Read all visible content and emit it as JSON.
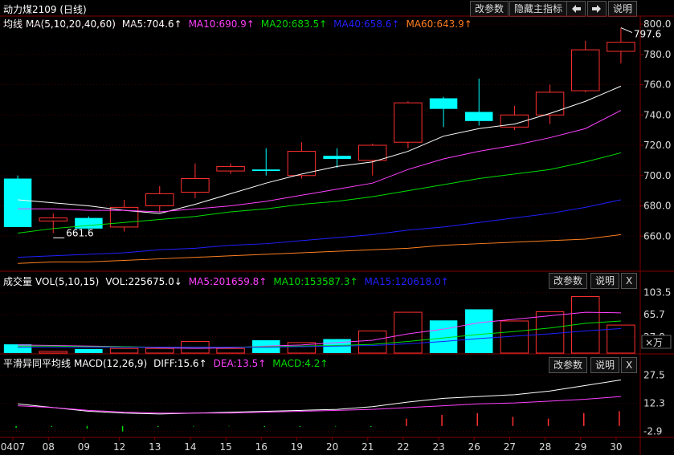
{
  "header": {
    "title": "动力煤2109 (日线)"
  },
  "toolbar": {
    "params_btn": "改参数",
    "hide_btn": "隐藏主指标",
    "left_icon": "arrow-left",
    "right_icon": "arrow-right",
    "help_btn": "说明"
  },
  "main_indicator": {
    "label": "均线",
    "params": "MA(5,10,20,40,60)",
    "ma5": "MA5:704.6↑",
    "ma10": "MA10:690.9↑",
    "ma20": "MA20:683.5↑",
    "ma40": "MA40:658.6↑",
    "ma60": "MA60:643.9↑"
  },
  "vol_panel": {
    "label": "成交量",
    "params": "VOL(5,10,15)",
    "vol": "VOL:225675.0↓",
    "ma5": "MA5:201659.8↑",
    "ma10": "MA10:153587.3↑",
    "ma15": "MA15:120618.0↑",
    "params_btn": "改参数",
    "help_btn": "说明",
    "close_btn": "X",
    "unit": "×万"
  },
  "macd_panel": {
    "label": "平滑异同平均线",
    "params": "MACD(12,26,9)",
    "diff": "DIFF:15.6↑",
    "dea": "DEA:13.5↑",
    "macd": "MACD:4.2↑",
    "params_btn": "改参数",
    "help_btn": "说明",
    "close_btn": "X"
  },
  "colors": {
    "up": "#ff3030",
    "down": "#00ffff",
    "ma5": "#ffffff",
    "ma10": "#ff40ff",
    "ma20": "#00dd00",
    "ma40": "#2020ff",
    "ma60": "#ff8020",
    "grid": "#800000"
  },
  "chart_data": {
    "type": "candlestick",
    "x_labels": [
      "0407",
      "08",
      "09",
      "12",
      "13",
      "14",
      "15",
      "16",
      "19",
      "20",
      "21",
      "22",
      "23",
      "26",
      "27",
      "28",
      "29",
      "30"
    ],
    "price_axis": {
      "ticks": [
        660.0,
        680.0,
        700.0,
        720.0,
        740.0,
        760.0,
        780.0,
        800.0
      ]
    },
    "price_annotations": {
      "high": "797.6",
      "low": "661.6"
    },
    "candles": [
      {
        "o": 698,
        "c": 666,
        "h": 700,
        "l": 666
      },
      {
        "o": 670,
        "c": 672,
        "h": 675,
        "l": 662
      },
      {
        "o": 672,
        "c": 665,
        "h": 673,
        "l": 664
      },
      {
        "o": 666,
        "c": 679,
        "h": 684,
        "l": 663
      },
      {
        "o": 680,
        "c": 688,
        "h": 693,
        "l": 676
      },
      {
        "o": 689,
        "c": 698,
        "h": 708,
        "l": 685
      },
      {
        "o": 703,
        "c": 706,
        "h": 708,
        "l": 701
      },
      {
        "o": 704,
        "c": 703,
        "h": 718,
        "l": 700
      },
      {
        "o": 700,
        "c": 716,
        "h": 722,
        "l": 698
      },
      {
        "o": 713,
        "c": 711,
        "h": 718,
        "l": 705
      },
      {
        "o": 710,
        "c": 720,
        "h": 721,
        "l": 700
      },
      {
        "o": 722,
        "c": 748,
        "h": 749,
        "l": 718
      },
      {
        "o": 751,
        "c": 744,
        "h": 752,
        "l": 732
      },
      {
        "o": 742,
        "c": 736,
        "h": 764,
        "l": 733
      },
      {
        "o": 732,
        "c": 740,
        "h": 746,
        "l": 730
      },
      {
        "o": 740,
        "c": 755,
        "h": 760,
        "l": 734
      },
      {
        "o": 756,
        "c": 783,
        "h": 789,
        "l": 755
      },
      {
        "o": 782,
        "c": 788,
        "h": 797.6,
        "l": 774
      }
    ],
    "ma_series": [
      {
        "name": "MA5",
        "values": [
          684,
          682,
          680,
          677,
          675,
          681,
          688,
          695,
          701,
          706,
          709,
          716,
          726,
          731,
          734,
          741,
          749,
          759
        ]
      },
      {
        "name": "MA10",
        "values": [
          678,
          678,
          677,
          677,
          676,
          678,
          680,
          683,
          687,
          691,
          695,
          704,
          711,
          716,
          720,
          725,
          731,
          743
        ]
      },
      {
        "name": "MA20",
        "values": [
          662,
          665,
          667,
          669,
          671,
          673,
          676,
          678,
          681,
          683,
          686,
          690,
          694,
          698,
          701,
          704,
          709,
          715
        ]
      },
      {
        "name": "MA40",
        "values": [
          646,
          647,
          648,
          649,
          651,
          652,
          654,
          655,
          657,
          659,
          661,
          664,
          666,
          669,
          672,
          675,
          679,
          684
        ]
      },
      {
        "name": "MA60",
        "values": [
          642,
          643,
          643,
          644,
          645,
          646,
          647,
          648,
          649,
          650,
          651,
          652,
          654,
          655,
          656,
          657,
          658,
          661
        ]
      }
    ],
    "volume": {
      "ticks": [
        "103.5",
        "65.7",
        "27.8"
      ],
      "values": [
        15,
        3,
        7,
        8,
        8,
        20,
        8,
        22,
        18,
        24,
        38,
        70,
        56,
        75,
        55,
        71,
        97,
        48
      ],
      "ma_series": [
        {
          "name": "MA5",
          "values": [
            14,
            13,
            12,
            11,
            9,
            8,
            9,
            12,
            14,
            18,
            22,
            33,
            41,
            52,
            58,
            64,
            70,
            69
          ]
        },
        {
          "name": "MA10",
          "values": [
            12,
            12,
            11,
            11,
            10,
            10,
            10,
            11,
            12,
            13,
            15,
            20,
            26,
            32,
            37,
            43,
            51,
            55
          ]
        },
        {
          "name": "MA15",
          "values": [
            10,
            10,
            10,
            10,
            10,
            10,
            10,
            10,
            11,
            12,
            13,
            16,
            20,
            25,
            29,
            33,
            38,
            42
          ]
        }
      ]
    },
    "macd": {
      "ticks": [
        "27.5",
        "12.3",
        "-2.9"
      ],
      "diff": [
        12,
        10,
        8,
        7,
        6.5,
        7,
        7.5,
        8,
        8.5,
        9,
        10.5,
        13,
        15,
        16,
        17,
        19,
        22,
        25
      ],
      "dea": [
        11,
        10,
        8.5,
        7.5,
        7,
        7,
        7,
        7.5,
        8,
        8.5,
        9,
        10,
        11,
        12,
        12.5,
        13.5,
        14.5,
        16
      ],
      "bars": [
        -1,
        -0.5,
        -1.5,
        -3,
        -0.5,
        -0.3,
        -0.2,
        -0.5,
        -0.5,
        -0.3,
        -0.5,
        4,
        6,
        7,
        5,
        4,
        7,
        8
      ]
    }
  }
}
